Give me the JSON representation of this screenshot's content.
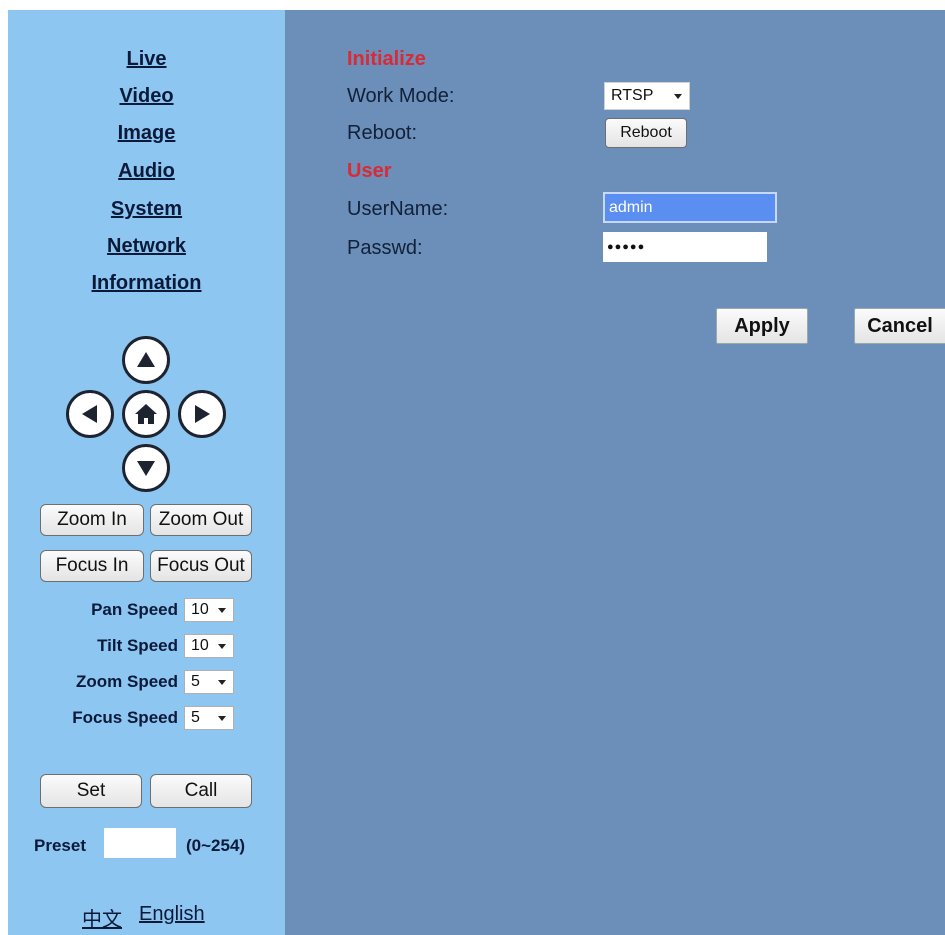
{
  "nav": {
    "items": [
      {
        "label": "Live"
      },
      {
        "label": "Video"
      },
      {
        "label": "Image"
      },
      {
        "label": "Audio"
      },
      {
        "label": "System"
      },
      {
        "label": "Network"
      },
      {
        "label": "Information"
      }
    ]
  },
  "ptz": {
    "direction_icons": [
      "up-arrow-icon",
      "left-arrow-icon",
      "home-icon",
      "right-arrow-icon",
      "down-arrow-icon"
    ],
    "zoom_in_label": "Zoom In",
    "zoom_out_label": "Zoom Out",
    "focus_in_label": "Focus In",
    "focus_out_label": "Focus Out",
    "speeds": [
      {
        "label": "Pan Speed",
        "value": "10"
      },
      {
        "label": "Tilt Speed",
        "value": "10"
      },
      {
        "label": "Zoom Speed",
        "value": "5"
      },
      {
        "label": "Focus Speed",
        "value": "5"
      }
    ],
    "set_label": "Set",
    "call_label": "Call",
    "preset_label": "Preset",
    "preset_value": "",
    "preset_range": "(0~254)"
  },
  "language": {
    "chinese": "中文",
    "english": "English"
  },
  "main": {
    "initialize_heading": "Initialize",
    "work_mode_label": "Work Mode:",
    "work_mode_value": "RTSP",
    "reboot_label": "Reboot:",
    "reboot_button": "Reboot",
    "user_heading": "User",
    "username_label": "UserName:",
    "username_value": "admin",
    "password_label": "Passwd:",
    "password_mask": "●●●●●",
    "apply_label": "Apply",
    "cancel_label": "Cancel"
  },
  "colors": {
    "sidebar_bg": "#8ec6f2",
    "main_bg": "#6b8fb8",
    "heading_red": "#d92a36",
    "username_highlight": "#5a8ef0"
  }
}
